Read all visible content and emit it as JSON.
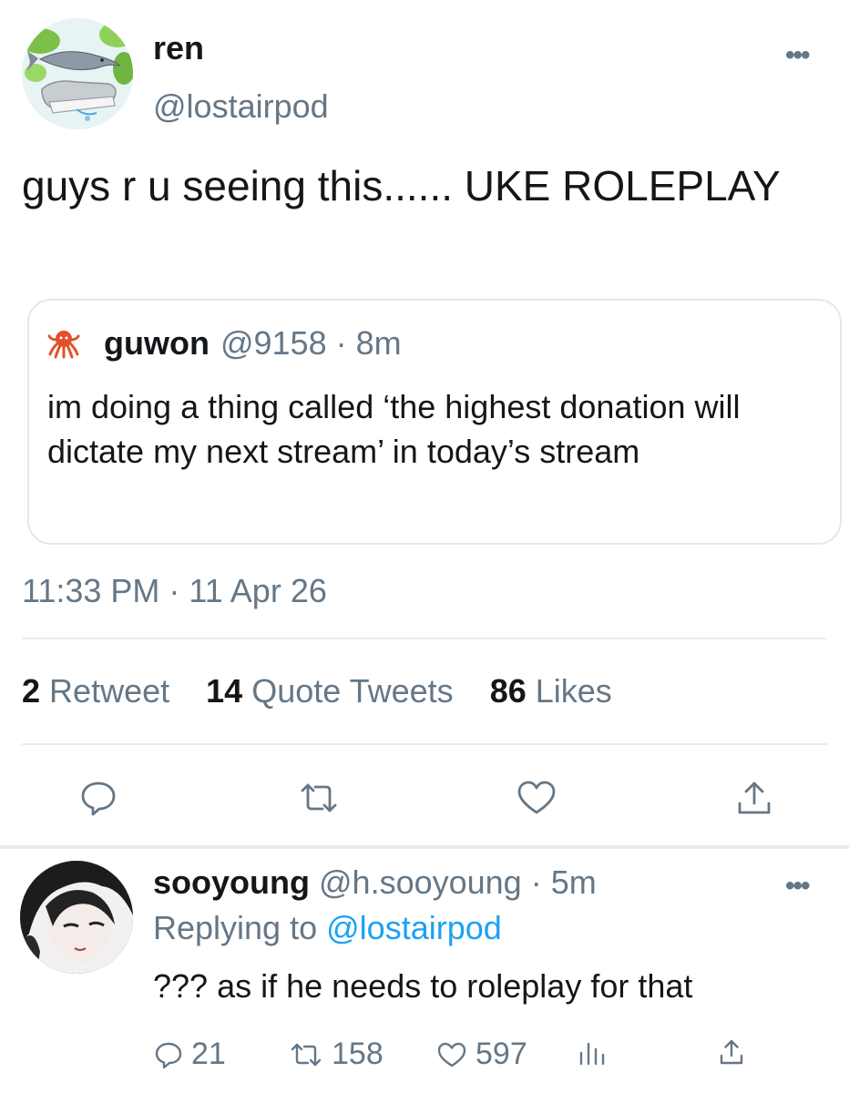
{
  "tweet": {
    "author_name": "ren",
    "author_handle": "@lostairpod",
    "text": "guys r u seeing this...... UKE ROLEPLAY",
    "more_glyph": "•••",
    "timestamp": "11:33 PM · 11 Apr 26",
    "stats": {
      "retweets_count": "2",
      "retweets_label": "Retweet",
      "quotes_count": "14",
      "quotes_label": "Quote Tweets",
      "likes_count": "86",
      "likes_label": "Likes"
    }
  },
  "quoted": {
    "author_name": "guwon",
    "meta": "@9158 · 8m",
    "text": "im doing a thing called ‘the highest donation will dictate my next stream’ in today’s stream",
    "avatar_icon": "octopus-icon"
  },
  "reply": {
    "author_name": "sooyoung",
    "meta": "@h.sooyoung · 5m",
    "replying_prefix": "Replying to",
    "replying_handle": "@lostairpod",
    "text": "??? as if he needs to roleplay for that",
    "more_glyph": "•••",
    "counts": {
      "replies": "21",
      "retweets": "158",
      "likes": "597"
    }
  },
  "colors": {
    "text_primary": "#14171a",
    "text_secondary": "#657786",
    "link": "#1da1f2",
    "border": "#e6ecf0"
  }
}
